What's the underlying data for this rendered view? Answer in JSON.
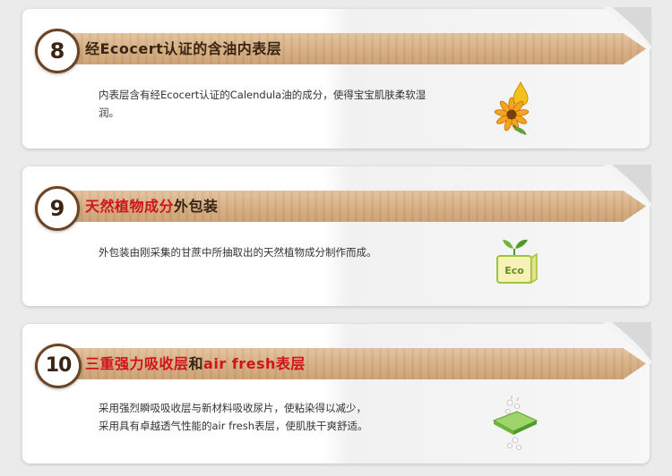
{
  "items": [
    {
      "number": "8",
      "title_plain": "经Ecocert认证的含油内表层",
      "description": "内表层含有经Ecocert认证的Calendula油的成分，使得宝宝肌肤柔软湿润。",
      "icon": "flower-oil-icon"
    },
    {
      "number": "9",
      "title_highlight": "天然植物成分",
      "title_rest": "外包装",
      "description": "外包装由刚采集的甘蔗中所抽取出的天然植物成分制作而成。",
      "icon": "eco-box-icon",
      "icon_label": "Eco"
    },
    {
      "number": "10",
      "title_highlight": "三重强力吸收层",
      "title_mid": "和",
      "title_highlight2": "air fresh表层",
      "description_line1": "采用强烈瞬吸吸收层与新材料吸收尿片，使粘染得以减少，",
      "description_line2": "采用具有卓越透气性能的air fresh表层，使肌肤干爽舒适。",
      "icon": "absorb-layer-icon"
    }
  ],
  "colors": {
    "highlight": "#d0141c",
    "wood": "#d5ad82",
    "badge_border": "#6a4424"
  }
}
